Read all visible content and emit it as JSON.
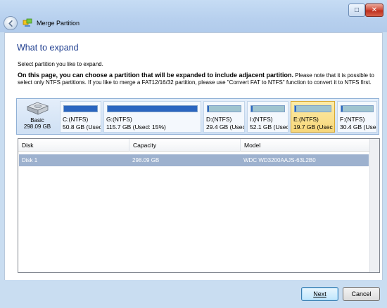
{
  "window": {
    "title": "Merge Partition",
    "maximize_glyph": "□",
    "close_glyph": "✕"
  },
  "page": {
    "heading": "What to expand",
    "instruction": "Select partition you like to expand.",
    "desc_bold": "On this page, you can choose a partition that will be expanded to include adjacent partition.",
    "desc_rest": " Please note that it is possible to select only NTFS partitions. If you like to merge a FAT12/16/32 partition, please use \"Convert FAT to NTFS\" function to convert it to NTFS first."
  },
  "disk_map": {
    "basic_label": "Basic",
    "basic_size": "298.09 GB",
    "partitions": [
      {
        "name": "C:(NTFS)",
        "size": "50.8 GB (Usec",
        "fill_fraction": 1.0,
        "selected": false
      },
      {
        "name": "G:(NTFS)",
        "size": "115.7 GB (Used: 15%)",
        "fill_fraction": 1.0,
        "selected": false
      },
      {
        "name": "D:(NTFS)",
        "size": "29.4 GB (Usec",
        "fill_fraction": 0.05,
        "selected": false
      },
      {
        "name": "I:(NTFS)",
        "size": "52.1 GB (Usec",
        "fill_fraction": 0.05,
        "selected": false
      },
      {
        "name": "E:(NTFS)",
        "size": "19.7 GB (Usec",
        "fill_fraction": 0.04,
        "selected": true
      },
      {
        "name": "F:(NTFS)",
        "size": "30.4 GB (Usec",
        "fill_fraction": 0.04,
        "selected": false
      }
    ]
  },
  "table": {
    "columns": [
      "Disk",
      "Capacity",
      "Model"
    ],
    "rows": [
      {
        "disk": "Disk 1",
        "capacity": "298.09 GB",
        "model": "WDC WD3200AAJS-63L2B0"
      }
    ]
  },
  "buttons": {
    "next": "Next",
    "cancel": "Cancel"
  },
  "colors": {
    "heading": "#1e3d8f",
    "selected_row": "#9db1ce",
    "selected_partition": "#f7d77a",
    "used_fill": "#2b66c0",
    "free_fill": "#9fc4cf"
  }
}
